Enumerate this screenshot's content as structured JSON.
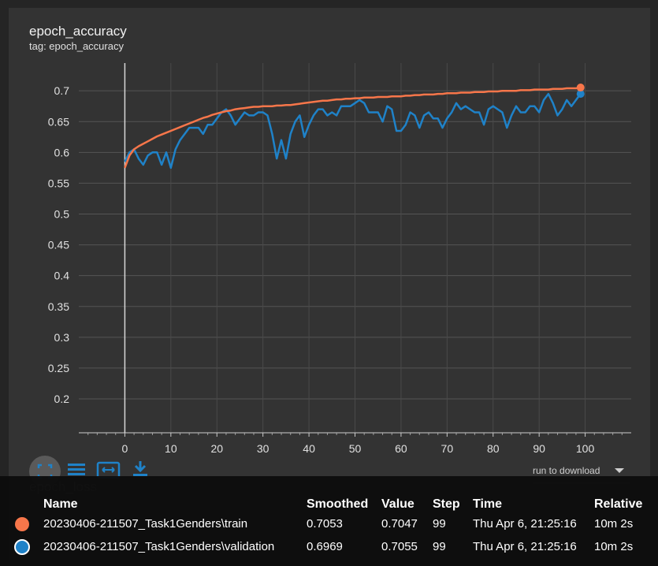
{
  "card": {
    "title": "epoch_accuracy",
    "subtitle": "tag: epoch_accuracy"
  },
  "toolbar": {
    "fit_icon": "fit-domain-icon",
    "log_icon": "list-icon",
    "expand_icon": "expand-icon",
    "download_icon": "download-icon",
    "download_select": "run to download",
    "next_card_title": "epoch_loss"
  },
  "colors": {
    "train": "#f7764a",
    "validation": "#1f82c8",
    "background": "#333333"
  },
  "chart_data": {
    "type": "line",
    "title": "epoch_accuracy",
    "xlabel": "",
    "ylabel": "",
    "xlim": [
      -10,
      110
    ],
    "ylim": [
      0.145,
      0.745
    ],
    "x_ticks": [
      0,
      10,
      20,
      30,
      40,
      50,
      60,
      70,
      80,
      90,
      100
    ],
    "y_ticks": [
      0.2,
      0.25,
      0.3,
      0.35,
      0.4,
      0.45,
      0.5,
      0.55,
      0.6,
      0.65,
      0.7
    ],
    "grid": true,
    "series": [
      {
        "name": "20230406-211507_Task1Genders\\train",
        "color": "#f7764a",
        "x": [
          0,
          1,
          2,
          3,
          4,
          5,
          6,
          7,
          8,
          9,
          10,
          11,
          12,
          13,
          14,
          15,
          16,
          17,
          18,
          19,
          20,
          21,
          22,
          23,
          24,
          25,
          26,
          27,
          28,
          29,
          30,
          31,
          32,
          33,
          34,
          35,
          36,
          37,
          38,
          39,
          40,
          41,
          42,
          43,
          44,
          45,
          46,
          47,
          48,
          49,
          50,
          51,
          52,
          53,
          54,
          55,
          56,
          57,
          58,
          59,
          60,
          61,
          62,
          63,
          64,
          65,
          66,
          67,
          68,
          69,
          70,
          71,
          72,
          73,
          74,
          75,
          76,
          77,
          78,
          79,
          80,
          81,
          82,
          83,
          84,
          85,
          86,
          87,
          88,
          89,
          90,
          91,
          92,
          93,
          94,
          95,
          96,
          97,
          98,
          99
        ],
        "values": [
          0.575,
          0.595,
          0.605,
          0.61,
          0.614,
          0.618,
          0.622,
          0.626,
          0.629,
          0.632,
          0.635,
          0.638,
          0.641,
          0.644,
          0.647,
          0.65,
          0.653,
          0.656,
          0.658,
          0.661,
          0.663,
          0.665,
          0.667,
          0.668,
          0.67,
          0.671,
          0.672,
          0.673,
          0.674,
          0.674,
          0.675,
          0.675,
          0.675,
          0.676,
          0.676,
          0.677,
          0.677,
          0.678,
          0.679,
          0.68,
          0.681,
          0.682,
          0.683,
          0.684,
          0.684,
          0.685,
          0.686,
          0.686,
          0.687,
          0.687,
          0.688,
          0.688,
          0.689,
          0.689,
          0.689,
          0.69,
          0.69,
          0.69,
          0.691,
          0.691,
          0.691,
          0.692,
          0.692,
          0.693,
          0.693,
          0.694,
          0.694,
          0.694,
          0.695,
          0.695,
          0.696,
          0.696,
          0.696,
          0.697,
          0.697,
          0.697,
          0.698,
          0.698,
          0.698,
          0.699,
          0.699,
          0.699,
          0.7,
          0.7,
          0.7,
          0.7,
          0.701,
          0.701,
          0.701,
          0.702,
          0.702,
          0.702,
          0.702,
          0.703,
          0.703,
          0.703,
          0.704,
          0.704,
          0.704,
          0.7053
        ]
      },
      {
        "name": "20230406-211507_Task1Genders\\validation",
        "color": "#1f82c8",
        "x": [
          0,
          1,
          2,
          3,
          4,
          5,
          6,
          7,
          8,
          9,
          10,
          11,
          12,
          13,
          14,
          15,
          16,
          17,
          18,
          19,
          20,
          21,
          22,
          23,
          24,
          25,
          26,
          27,
          28,
          29,
          30,
          31,
          32,
          33,
          34,
          35,
          36,
          37,
          38,
          39,
          40,
          41,
          42,
          43,
          44,
          45,
          46,
          47,
          48,
          49,
          50,
          51,
          52,
          53,
          54,
          55,
          56,
          57,
          58,
          59,
          60,
          61,
          62,
          63,
          64,
          65,
          66,
          67,
          68,
          69,
          70,
          71,
          72,
          73,
          74,
          75,
          76,
          77,
          78,
          79,
          80,
          81,
          82,
          83,
          84,
          85,
          86,
          87,
          88,
          89,
          90,
          91,
          92,
          93,
          94,
          95,
          96,
          97,
          98,
          99
        ],
        "values": [
          0.585,
          0.6,
          0.605,
          0.59,
          0.58,
          0.595,
          0.6,
          0.6,
          0.58,
          0.6,
          0.575,
          0.605,
          0.62,
          0.63,
          0.64,
          0.64,
          0.64,
          0.63,
          0.645,
          0.645,
          0.655,
          0.665,
          0.67,
          0.66,
          0.645,
          0.655,
          0.665,
          0.66,
          0.66,
          0.665,
          0.665,
          0.66,
          0.63,
          0.59,
          0.62,
          0.59,
          0.63,
          0.65,
          0.66,
          0.625,
          0.645,
          0.66,
          0.67,
          0.67,
          0.66,
          0.665,
          0.66,
          0.675,
          0.675,
          0.675,
          0.68,
          0.685,
          0.68,
          0.665,
          0.665,
          0.665,
          0.65,
          0.675,
          0.67,
          0.635,
          0.635,
          0.645,
          0.665,
          0.66,
          0.64,
          0.66,
          0.665,
          0.655,
          0.655,
          0.64,
          0.655,
          0.665,
          0.68,
          0.67,
          0.675,
          0.67,
          0.665,
          0.665,
          0.645,
          0.67,
          0.675,
          0.67,
          0.665,
          0.64,
          0.66,
          0.675,
          0.665,
          0.665,
          0.675,
          0.675,
          0.665,
          0.685,
          0.695,
          0.68,
          0.66,
          0.67,
          0.685,
          0.675,
          0.685,
          0.695
        ]
      }
    ]
  },
  "tooltip": {
    "headers": {
      "name": "Name",
      "smoothed": "Smoothed",
      "value": "Value",
      "step": "Step",
      "time": "Time",
      "relative": "Relative"
    },
    "rows": [
      {
        "name": "20230406-211507_Task1Genders\\train",
        "smoothed": "0.7053",
        "value": "0.7047",
        "step": "99",
        "time": "Thu Apr 6, 21:25:16",
        "relative": "10m 2s",
        "color": "#f7764a"
      },
      {
        "name": "20230406-211507_Task1Genders\\validation",
        "smoothed": "0.6969",
        "value": "0.7055",
        "step": "99",
        "time": "Thu Apr 6, 21:25:16",
        "relative": "10m 2s",
        "color": "#1f82c8"
      }
    ]
  }
}
